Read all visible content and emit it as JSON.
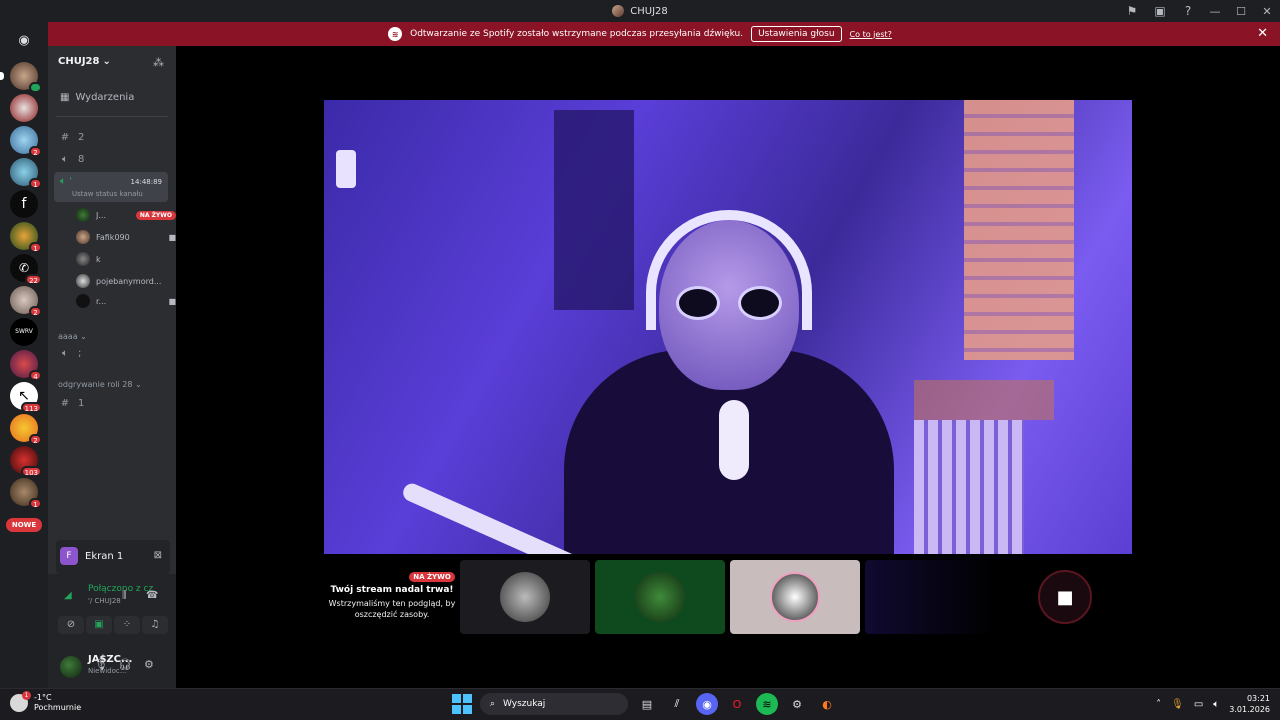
{
  "titlebar": {
    "title": "CHUJ28"
  },
  "banner": {
    "message": "Odtwarzanie ze Spotify zostało wstrzymane podczas przesyłania dźwięku.",
    "settings_button": "Ustawienia głosu",
    "link": "Co to jest?"
  },
  "rail": {
    "servers": [
      {
        "badge": ""
      },
      {
        "badge": ""
      },
      {
        "badge": "2"
      },
      {
        "badge": "1"
      },
      {
        "badge": ""
      },
      {
        "badge": "1"
      },
      {
        "badge": "22"
      },
      {
        "badge": "2"
      },
      {
        "badge": ""
      },
      {
        "badge": "4"
      },
      {
        "badge": "113"
      },
      {
        "badge": "2"
      },
      {
        "badge": "103"
      },
      {
        "badge": "1"
      }
    ],
    "new_label": "NOWE"
  },
  "sidebar": {
    "server_name": "CHUJ28",
    "events": "Wydarzenia",
    "channels": [
      {
        "name": "2"
      },
      {
        "name": "8"
      }
    ],
    "active_channel": {
      "name": "'",
      "time": "14:48:89",
      "status": "Ustaw status kanału"
    },
    "voice_users": [
      {
        "name": "J...",
        "live": "NA ŻYWO"
      },
      {
        "name": "Fafik090"
      },
      {
        "name": "k"
      },
      {
        "name": "pojebanymord..."
      },
      {
        "name": "r..."
      }
    ],
    "category1": "aaaa",
    "channel_voice2": ";",
    "category2": "odgrywanie roli 28",
    "channel_text3": "1"
  },
  "stream": {
    "label": "Ekran 1"
  },
  "voice": {
    "status": "Połączono z cz",
    "server": "'/ CHUJ28"
  },
  "user": {
    "name": "JA$ZC...",
    "status": "Niewidoc..."
  },
  "stage": {
    "live": "NA ŻYWO",
    "paused_title": "Twój stream nadal trwa!",
    "paused_msg": "Wstrzymaliśmy ten podgląd, by oszczędzić zasoby."
  },
  "taskbar": {
    "weather_temp": "-1°C",
    "weather_desc": "Pochmurnie",
    "weather_badge": "1",
    "search": "Wyszukaj",
    "time": "03:21",
    "date": "3.01.2026"
  },
  "colors": {
    "banner": "#8a1325",
    "live_red": "#da373c",
    "connected_green": "#23a559",
    "video_purple": "#5a3ed8"
  }
}
